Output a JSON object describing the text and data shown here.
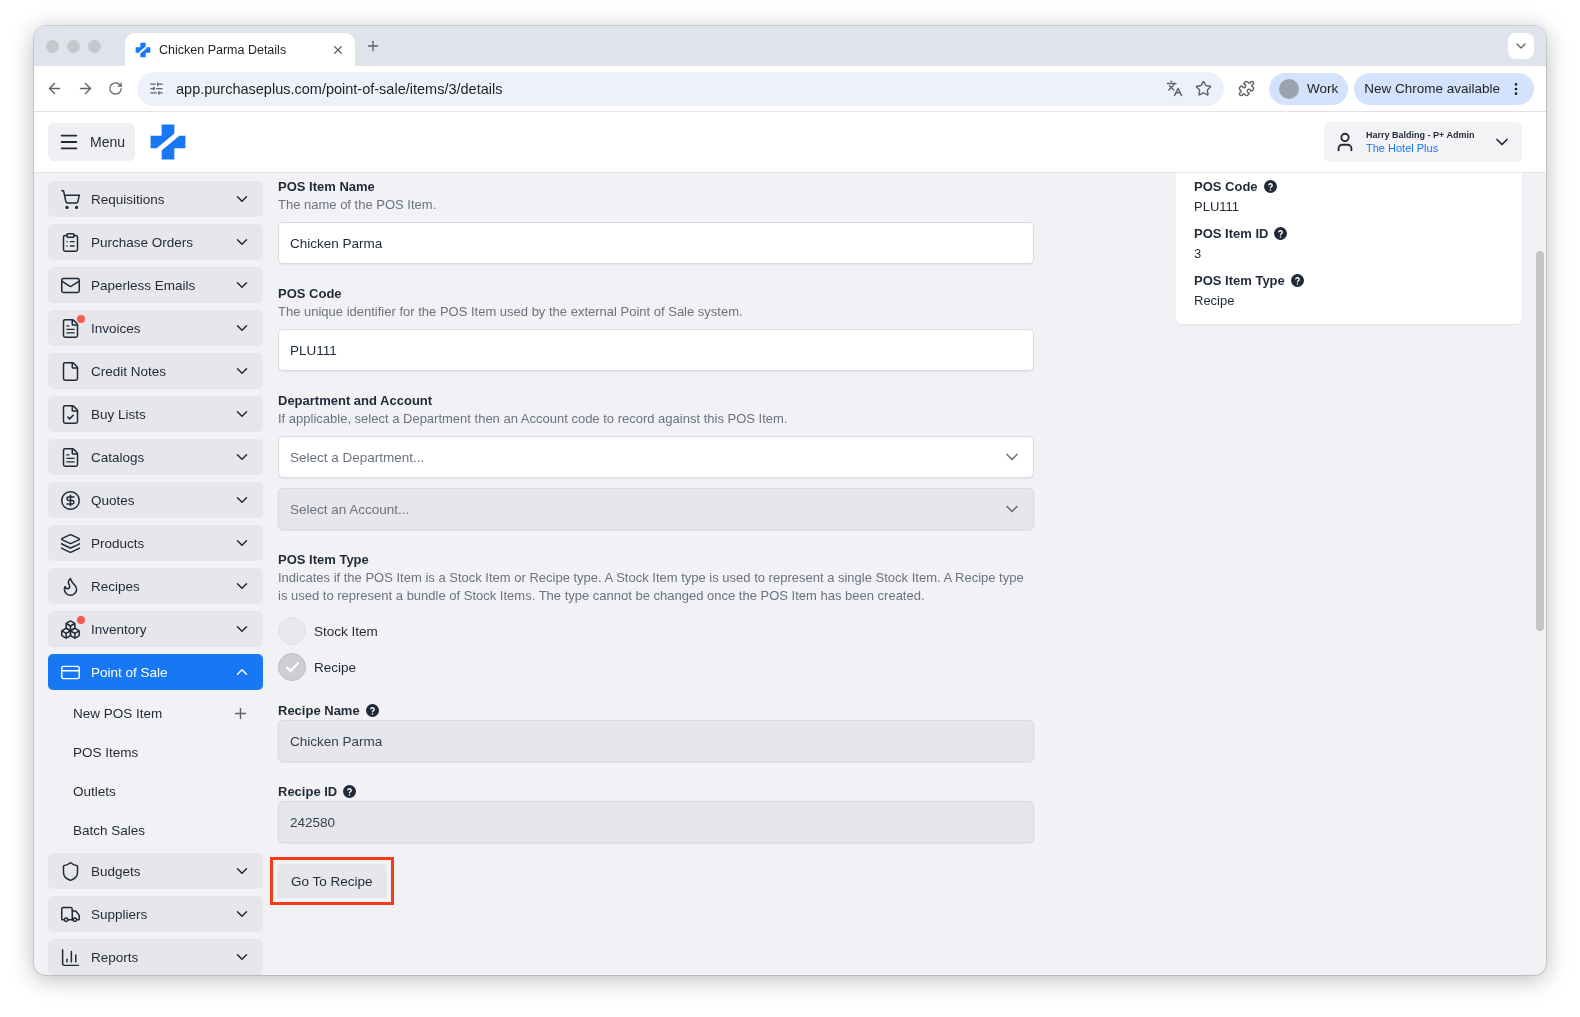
{
  "browser": {
    "tab_title": "Chicken Parma Details",
    "url": "app.purchaseplus.com/point-of-sale/items/3/details",
    "profile": "Work",
    "update": "New Chrome available"
  },
  "header": {
    "menu": "Menu",
    "user_name": "Harry Balding - P+ Admin",
    "organisation": "The Hotel Plus"
  },
  "sidebar": {
    "items": [
      {
        "label": "Requisitions",
        "badge": false,
        "expanded": false,
        "selected": false
      },
      {
        "label": "Purchase Orders",
        "badge": false,
        "expanded": false,
        "selected": false
      },
      {
        "label": "Paperless Emails",
        "badge": false,
        "expanded": false,
        "selected": false
      },
      {
        "label": "Invoices",
        "badge": true,
        "expanded": false,
        "selected": false
      },
      {
        "label": "Credit Notes",
        "badge": false,
        "expanded": false,
        "selected": false
      },
      {
        "label": "Buy Lists",
        "badge": false,
        "expanded": false,
        "selected": false
      },
      {
        "label": "Catalogs",
        "badge": false,
        "expanded": false,
        "selected": false
      },
      {
        "label": "Quotes",
        "badge": false,
        "expanded": false,
        "selected": false
      },
      {
        "label": "Products",
        "badge": false,
        "expanded": false,
        "selected": false
      },
      {
        "label": "Recipes",
        "badge": false,
        "expanded": false,
        "selected": false
      },
      {
        "label": "Inventory",
        "badge": true,
        "expanded": false,
        "selected": false
      },
      {
        "label": "Point of Sale",
        "badge": false,
        "expanded": true,
        "selected": true,
        "children": [
          {
            "label": "New POS Item",
            "kind": "add"
          },
          {
            "label": "POS Items",
            "kind": "link"
          },
          {
            "label": "Outlets",
            "kind": "link"
          },
          {
            "label": "Batch Sales",
            "kind": "link"
          }
        ]
      },
      {
        "label": "Budgets",
        "badge": false,
        "expanded": false,
        "selected": false
      },
      {
        "label": "Suppliers",
        "badge": false,
        "expanded": false,
        "selected": false
      },
      {
        "label": "Reports",
        "badge": false,
        "expanded": false,
        "selected": false
      }
    ]
  },
  "form": {
    "fields": [
      {
        "kind": "text",
        "label": "POS Item Name",
        "hint": "The name of the POS Item.",
        "value": "Chicken Parma",
        "disabled": false
      },
      {
        "kind": "text",
        "label": "POS Code",
        "hint": "The unique identifier for the POS Item used by the external Point of Sale system.",
        "value": "PLU111",
        "disabled": false
      },
      {
        "kind": "select",
        "label": "Department and Account",
        "hint": "If applicable, select a Department then an Account code to record against this POS Item.",
        "selects": [
          {
            "placeholder": "Select a Department...",
            "disabled": false
          },
          {
            "placeholder": "Select an Account...",
            "disabled": true
          }
        ]
      },
      {
        "kind": "radio",
        "label": "POS Item Type",
        "hint": "Indicates if the POS Item is a Stock Item or Recipe type. A Stock Item type is used to represent a single Stock Item. A Recipe type is used to represent a bundle of Stock Items. The type cannot be changed once the POS Item has been created.",
        "options": [
          {
            "label": "Stock Item",
            "selected": false
          },
          {
            "label": "Recipe",
            "selected": true
          }
        ]
      },
      {
        "kind": "text",
        "label": "Recipe Name",
        "help": true,
        "value": "Chicken Parma",
        "disabled": true
      },
      {
        "kind": "text",
        "label": "Recipe ID",
        "help": true,
        "value": "242580",
        "disabled": true
      }
    ],
    "button": {
      "label": "Go To Recipe",
      "highlighted": true
    }
  },
  "details": [
    {
      "label": "POS Code",
      "value": "PLU111"
    },
    {
      "label": "POS Item ID",
      "value": "3"
    },
    {
      "label": "POS Item Type",
      "value": "Recipe"
    }
  ]
}
